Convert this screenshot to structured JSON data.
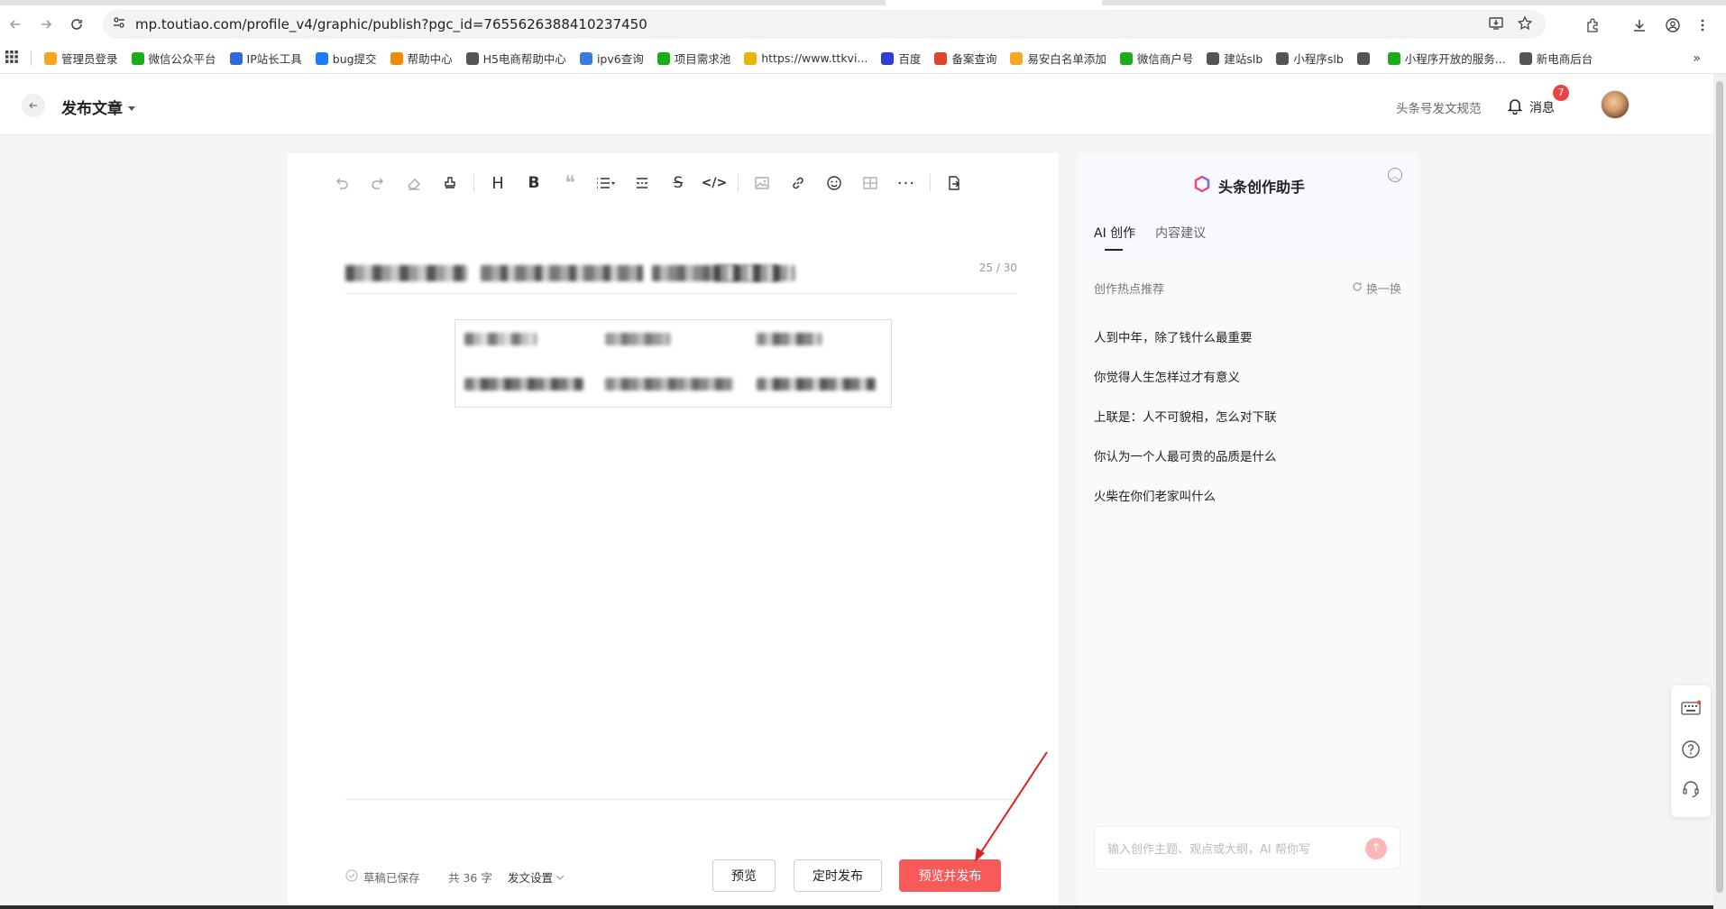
{
  "browser": {
    "url": "mp.toutiao.com/profile_v4/graphic/publish?pgc_id=7655626388410237450",
    "bookmarks": [
      {
        "label": "管理员登录",
        "color": "#f5a623"
      },
      {
        "label": "微信公众平台",
        "color": "#1aad19"
      },
      {
        "label": "IP站长工具",
        "color": "#2f6bd8"
      },
      {
        "label": "bug提交",
        "color": "#1e7bff"
      },
      {
        "label": "帮助中心",
        "color": "#f08a00"
      },
      {
        "label": "H5电商帮助中心",
        "color": "#555555"
      },
      {
        "label": "ipv6查询",
        "color": "#3a7be0"
      },
      {
        "label": "项目需求池",
        "color": "#1aad19"
      },
      {
        "label": "https://www.ttkvi...",
        "color": "#e8b400"
      },
      {
        "label": "百度",
        "color": "#2f3ddb"
      },
      {
        "label": "备案查询",
        "color": "#e0442c"
      },
      {
        "label": "易安白名单添加",
        "color": "#f5a623"
      },
      {
        "label": "微信商户号",
        "color": "#1aad19"
      },
      {
        "label": "建站slb",
        "color": "#555555"
      },
      {
        "label": "小程序slb",
        "color": "#555555"
      },
      {
        "label": "",
        "color": "#555555"
      },
      {
        "label": "小程序开放的服务...",
        "color": "#1aad19"
      },
      {
        "label": "新电商后台",
        "color": "#555555"
      }
    ]
  },
  "header": {
    "title": "发布文章",
    "rules_link": "头条号发文规范",
    "messages_label": "消息",
    "messages_badge": "7"
  },
  "editor": {
    "title_counter": "25 / 30",
    "footer": {
      "saved": "草稿已保存",
      "word_count": "共 36 字",
      "settings": "发文设置"
    },
    "buttons": {
      "preview": "预览",
      "schedule": "定时发布",
      "publish": "预览并发布"
    }
  },
  "assistant": {
    "title": "头条创作助手",
    "tabs": [
      "AI 创作",
      "内容建议"
    ],
    "hot_label": "创作热点推荐",
    "refresh": "换一换",
    "hot_topics": [
      "人到中年，除了钱什么最重要",
      "你觉得人生怎样过才有意义",
      "上联是：人不可貌相，怎么对下联",
      "你认为一个人最可贵的品质是什么",
      "火柴在你们老家叫什么"
    ],
    "input_placeholder": "输入创作主题、观点或大纲，AI 帮你写"
  }
}
